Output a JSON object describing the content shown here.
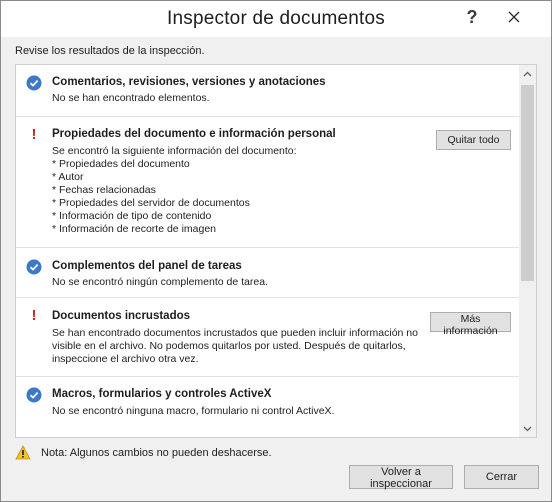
{
  "dialog": {
    "title": "Inspector de documentos",
    "help_icon": "help-icon",
    "close_icon": "close-icon"
  },
  "subtitle": "Revise los resultados de la inspección.",
  "sections": [
    {
      "status": "ok",
      "icon": "check-circle-icon",
      "title": "Comentarios, revisiones, versiones y anotaciones",
      "body": "No se han encontrado elementos."
    },
    {
      "status": "warning",
      "icon": "exclamation-icon",
      "title": "Propiedades del documento e información personal",
      "body": "Se encontró la siguiente información del documento:\n* Propiedades del documento\n* Autor\n* Fechas relacionadas\n* Propiedades del servidor de documentos\n* Información de tipo de contenido\n* Información de recorte de imagen",
      "button": "Quitar todo"
    },
    {
      "status": "ok",
      "icon": "check-circle-icon",
      "title": "Complementos del panel de tareas",
      "body": "No se encontró ningún complemento de tarea."
    },
    {
      "status": "warning",
      "icon": "exclamation-icon",
      "title": "Documentos incrustados",
      "body": "Se han encontrado documentos incrustados que pueden incluir información no\nvisible en el archivo. No podemos quitarlos por usted. Después de quitarlos,\ninspeccione el archivo otra vez.",
      "button": "Más información"
    },
    {
      "status": "ok",
      "icon": "check-circle-icon",
      "title": "Macros, formularios y controles ActiveX",
      "body": "No se encontró ninguna macro, formulario ni control ActiveX."
    }
  ],
  "note": {
    "icon": "warning-triangle-icon",
    "text": "Nota: Algunos cambios no pueden deshacerse."
  },
  "buttons": {
    "reinspect": "Volver a inspeccionar",
    "close": "Cerrar"
  },
  "colors": {
    "check_blue": "#3c78c8",
    "exclaim_red": "#c42b1c",
    "warning_yellow": "#f2c12e"
  }
}
